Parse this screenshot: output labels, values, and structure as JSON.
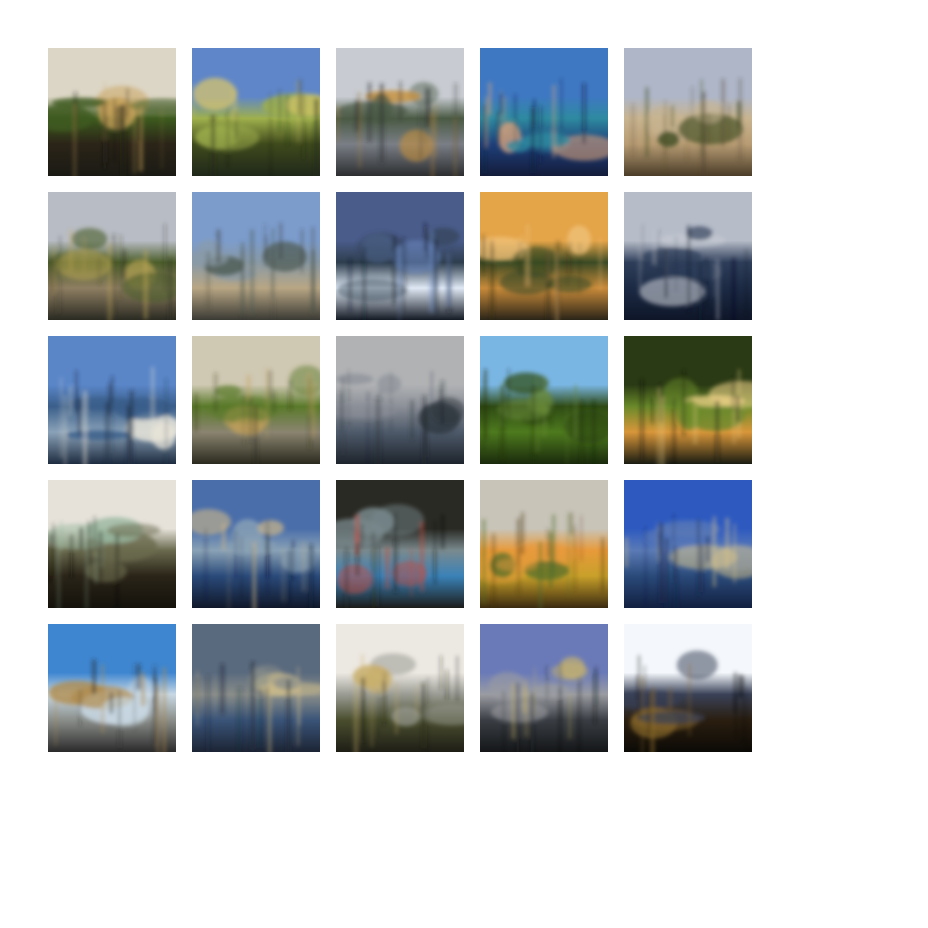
{
  "grid": {
    "description_tiles": 25,
    "tiles": [
      {
        "sky": "#dcd6c6",
        "ground": "#2b2418",
        "mid": "#3d5a1e",
        "accent": "#c9a25a",
        "band": "#1a1a14"
      },
      {
        "sky": "#5f86c8",
        "ground": "#3f4a1c",
        "mid": "#9fb04c",
        "accent": "#d9c56a",
        "band": "#20281a"
      },
      {
        "sky": "#c8ccd2",
        "ground": "#7a7e86",
        "mid": "#4a5a44",
        "accent": "#c8903a",
        "band": "#2c2e30"
      },
      {
        "sky": "#3e78c2",
        "ground": "#1e3f7a",
        "mid": "#2e8aa0",
        "accent": "#d8a27a",
        "band": "#141c3a"
      },
      {
        "sky": "#aeb6c8",
        "ground": "#b89c74",
        "mid": "#c8b490",
        "accent": "#3a4a1e",
        "band": "#4a3c28"
      },
      {
        "sky": "#b8bcc4",
        "ground": "#8e7e62",
        "mid": "#4c5e2a",
        "accent": "#c8ae5a",
        "band": "#2a2a22"
      },
      {
        "sky": "#7c9ccc",
        "ground": "#b8a684",
        "mid": "#8a9aa6",
        "accent": "#4c5a52",
        "band": "#3a3a34"
      },
      {
        "sky": "#4a5c8a",
        "ground": "#dfe8f4",
        "mid": "#2e3e4e",
        "accent": "#6a8ac2",
        "band": "#141a24"
      },
      {
        "sky": "#e4a448",
        "ground": "#c88a3a",
        "mid": "#3a4a24",
        "accent": "#f0c27a",
        "band": "#2a2418"
      },
      {
        "sky": "#b6bcc8",
        "ground": "#1c2a44",
        "mid": "#2e3e5a",
        "accent": "#c8ccd4",
        "band": "#0e1628"
      },
      {
        "sky": "#5a86c8",
        "ground": "#8aa2b8",
        "mid": "#3a5e8a",
        "accent": "#e8e4d8",
        "band": "#1e2c40"
      },
      {
        "sky": "#cfc8b2",
        "ground": "#8a8470",
        "mid": "#5a7a2a",
        "accent": "#c2a05a",
        "band": "#2a2a1e"
      },
      {
        "sky": "#b0b2b4",
        "ground": "#4e5a6a",
        "mid": "#8c9098",
        "accent": "#2a3038",
        "band": "#1e242c"
      },
      {
        "sky": "#7ab6e4",
        "ground": "#4e7a1e",
        "mid": "#2e4a14",
        "accent": "#6a8a3a",
        "band": "#1a2a0c"
      },
      {
        "sky": "#2a3a14",
        "ground": "#d8963a",
        "mid": "#6a8a2a",
        "accent": "#f0d28a",
        "band": "#1a1c12"
      },
      {
        "sky": "#e6e2da",
        "ground": "#2a2418",
        "mid": "#6a6a4e",
        "accent": "#9ab8a0",
        "band": "#14120c"
      },
      {
        "sky": "#4a6eaa",
        "ground": "#2a4a7a",
        "mid": "#8aa2b6",
        "accent": "#c8b48a",
        "band": "#10182a"
      },
      {
        "sky": "#2a2a24",
        "ground": "#3a82b8",
        "mid": "#7a8a8e",
        "accent": "#c84a3a",
        "band": "#1c1c1a"
      },
      {
        "sky": "#c8c4b8",
        "ground": "#c8a02a",
        "mid": "#e89a3a",
        "accent": "#4a6a2a",
        "band": "#3a2a10"
      },
      {
        "sky": "#2e5ac0",
        "ground": "#2a4a7a",
        "mid": "#5a7ab6",
        "accent": "#d8c48a",
        "band": "#122040"
      },
      {
        "sky": "#3e86d0",
        "ground": "#8a8e8a",
        "mid": "#c8d8e4",
        "accent": "#b08a4a",
        "band": "#2a2a2a"
      },
      {
        "sky": "#5a6a7e",
        "ground": "#3a5478",
        "mid": "#8a8e8a",
        "accent": "#d8c48a",
        "band": "#1c2434"
      },
      {
        "sky": "#ece8e2",
        "ground": "#4a4e2e",
        "mid": "#9a9c94",
        "accent": "#c8ae6a",
        "band": "#1e1e16"
      },
      {
        "sky": "#6a7ab8",
        "ground": "#3a3e44",
        "mid": "#9a9ca2",
        "accent": "#c8b46a",
        "band": "#141618"
      },
      {
        "sky": "#f4f8fc",
        "ground": "#2a1e10",
        "mid": "#3a4258",
        "accent": "#8a6a2a",
        "band": "#0c0a06"
      }
    ]
  }
}
